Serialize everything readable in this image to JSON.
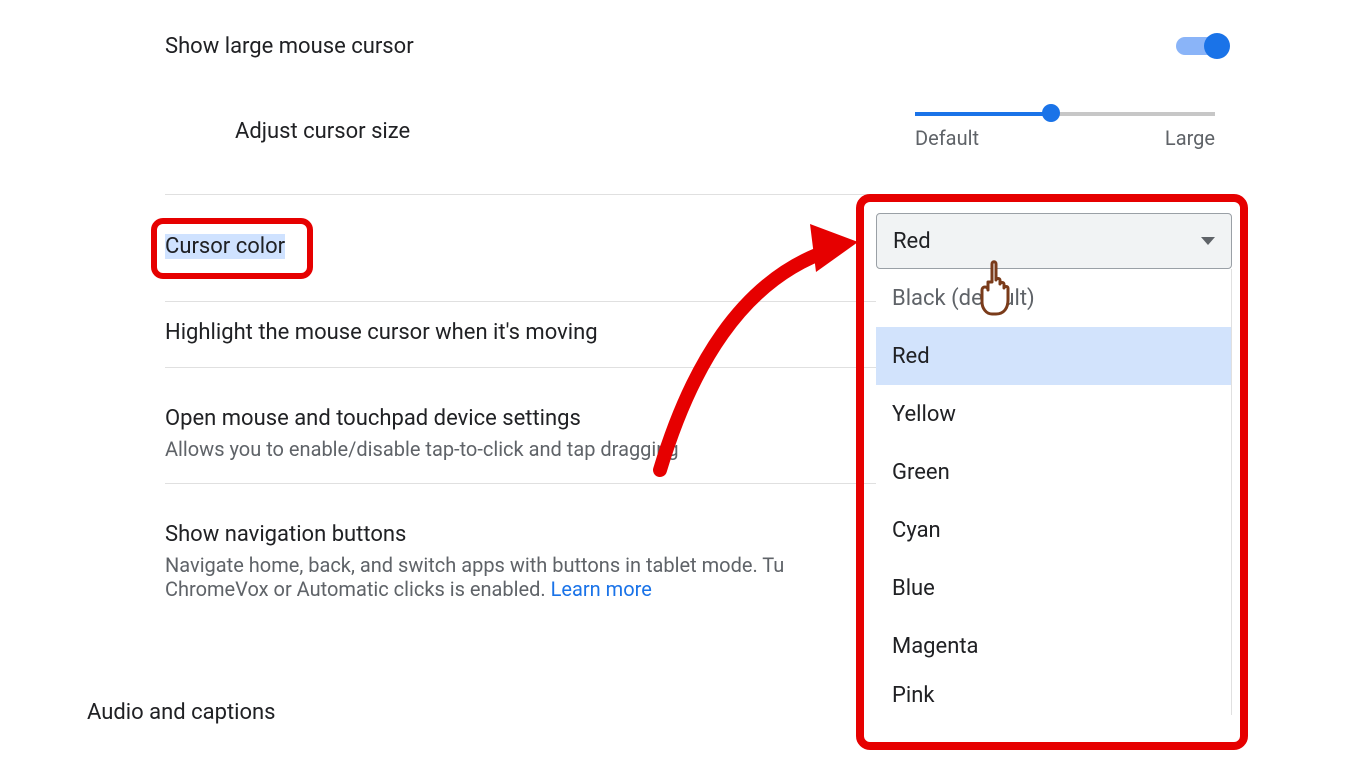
{
  "rows": {
    "large_cursor": "Show large mouse cursor",
    "adjust_size": "Adjust cursor size",
    "slider_min": "Default",
    "slider_max": "Large",
    "cursor_color": "Cursor color",
    "highlight_moving": "Highlight the mouse cursor when it's moving",
    "open_device": "Open mouse and touchpad device settings",
    "open_device_sub": "Allows you to enable/disable tap-to-click and tap dragging",
    "nav_buttons": "Show navigation buttons",
    "nav_buttons_sub_a": "Navigate home, back, and switch apps with buttons in tablet mode. Tu",
    "nav_buttons_sub_b": "ChromeVox or Automatic clicks is enabled.  ",
    "learn_more": "Learn more"
  },
  "section2": "Audio and captions",
  "dropdown": {
    "selected": "Red",
    "options": {
      "o0": "Black (default)",
      "o1": "Red",
      "o2": "Yellow",
      "o3": "Green",
      "o4": "Cyan",
      "o5": "Blue",
      "o6": "Magenta",
      "o7": "Pink"
    }
  }
}
